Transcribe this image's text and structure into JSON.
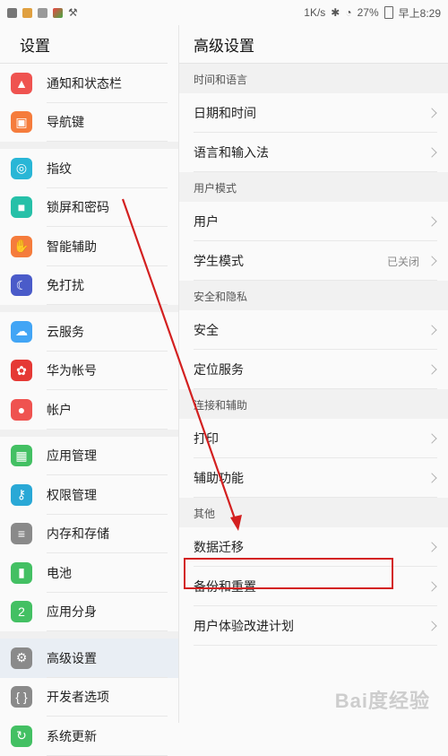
{
  "status_bar": {
    "speed": "1K/s",
    "battery": "27%",
    "time": "早上8:29"
  },
  "left_pane": {
    "title": "设置",
    "items": [
      {
        "label": "通知和状态栏",
        "icon": "bell-icon",
        "color": "#ef5350"
      },
      {
        "label": "导航键",
        "icon": "navigation-key-icon",
        "color": "#f57c3c"
      },
      {
        "label": "指纹",
        "icon": "fingerprint-icon",
        "color": "#29b6d6"
      },
      {
        "label": "锁屏和密码",
        "icon": "lock-icon",
        "color": "#26c0a8"
      },
      {
        "label": "智能辅助",
        "icon": "hand-icon",
        "color": "#f57c3c"
      },
      {
        "label": "免打扰",
        "icon": "moon-icon",
        "color": "#4a5bc9"
      },
      {
        "label": "云服务",
        "icon": "cloud-icon",
        "color": "#42a5f5"
      },
      {
        "label": "华为帐号",
        "icon": "huawei-icon",
        "color": "#e53935"
      },
      {
        "label": "帐户",
        "icon": "account-icon",
        "color": "#ef5350"
      },
      {
        "label": "应用管理",
        "icon": "apps-icon",
        "color": "#43c063"
      },
      {
        "label": "权限管理",
        "icon": "key-icon",
        "color": "#29a8d6"
      },
      {
        "label": "内存和存储",
        "icon": "storage-icon",
        "color": "#8a8a8a"
      },
      {
        "label": "电池",
        "icon": "battery-icon",
        "color": "#43c063"
      },
      {
        "label": "应用分身",
        "icon": "app-twin-icon",
        "color": "#43c063"
      },
      {
        "label": "高级设置",
        "icon": "gear-icon",
        "color": "#8a8a8a"
      },
      {
        "label": "开发者选项",
        "icon": "braces-icon",
        "color": "#8a8a8a"
      },
      {
        "label": "系统更新",
        "icon": "update-icon",
        "color": "#43c063"
      }
    ]
  },
  "right_pane": {
    "title": "高级设置",
    "sections": [
      {
        "header": "时间和语言",
        "items": [
          {
            "label": "日期和时间"
          },
          {
            "label": "语言和输入法"
          }
        ]
      },
      {
        "header": "用户模式",
        "items": [
          {
            "label": "用户"
          },
          {
            "label": "学生模式",
            "value": "已关闭"
          }
        ]
      },
      {
        "header": "安全和隐私",
        "items": [
          {
            "label": "安全"
          },
          {
            "label": "定位服务"
          }
        ]
      },
      {
        "header": "连接和辅助",
        "items": [
          {
            "label": "打印"
          },
          {
            "label": "辅助功能"
          }
        ]
      },
      {
        "header": "其他",
        "items": [
          {
            "label": "数据迁移"
          },
          {
            "label": "备份和重置"
          },
          {
            "label": "用户体验改进计划"
          }
        ]
      }
    ]
  },
  "watermark": "Bai度经验",
  "colors": {
    "annotation_red": "#d32020",
    "active_bg": "#e9eef4"
  }
}
